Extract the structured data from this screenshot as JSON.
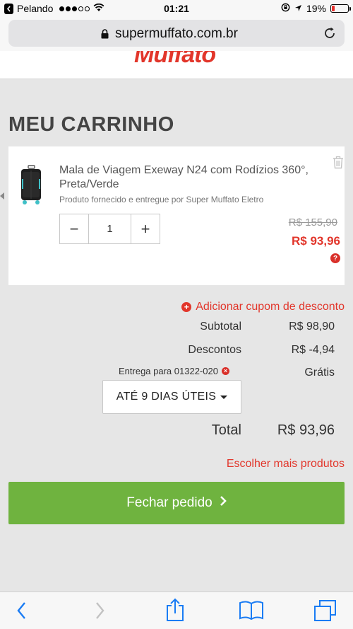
{
  "status_bar": {
    "carrier": "Pelando",
    "time": "01:21",
    "battery_percent": "19%",
    "battery_level": 0.19,
    "battery_color": "#e8302c"
  },
  "browser": {
    "url": "supermuffato.com.br",
    "lock_icon": "lock-icon",
    "reload_icon": "reload-icon"
  },
  "site": {
    "logo_text": "Muffato",
    "brand_color": "#e2362b"
  },
  "page": {
    "title": "MEU CARRINHO"
  },
  "cart_item": {
    "name": "Mala de Viagem Exeway N24 com Rodízios 360°, Preta/Verde",
    "vendor": "Produto fornecido e entregue por Super Muffato Eletro",
    "quantity": "1",
    "minus_label": "−",
    "plus_label": "+",
    "old_price": "R$ 155,90",
    "price": "R$ 93,96",
    "help_label": "?"
  },
  "coupon": {
    "label": "Adicionar cupom de desconto",
    "icon": "+"
  },
  "summary": {
    "subtotal_label": "Subtotal",
    "subtotal_value": "R$ 98,90",
    "discount_label": "Descontos",
    "discount_value": "R$ -4,94",
    "delivery_label": "Entrega para 01322-020",
    "delivery_remove": "×",
    "delivery_value": "Grátis",
    "deadline": "ATÉ 9 DIAS ÚTEIS",
    "total_label": "Total",
    "total_value": "R$ 93,96"
  },
  "actions": {
    "more_products": "Escolher mais produtos",
    "checkout": "Fechar pedido",
    "checkout_color": "#6fb33f"
  }
}
